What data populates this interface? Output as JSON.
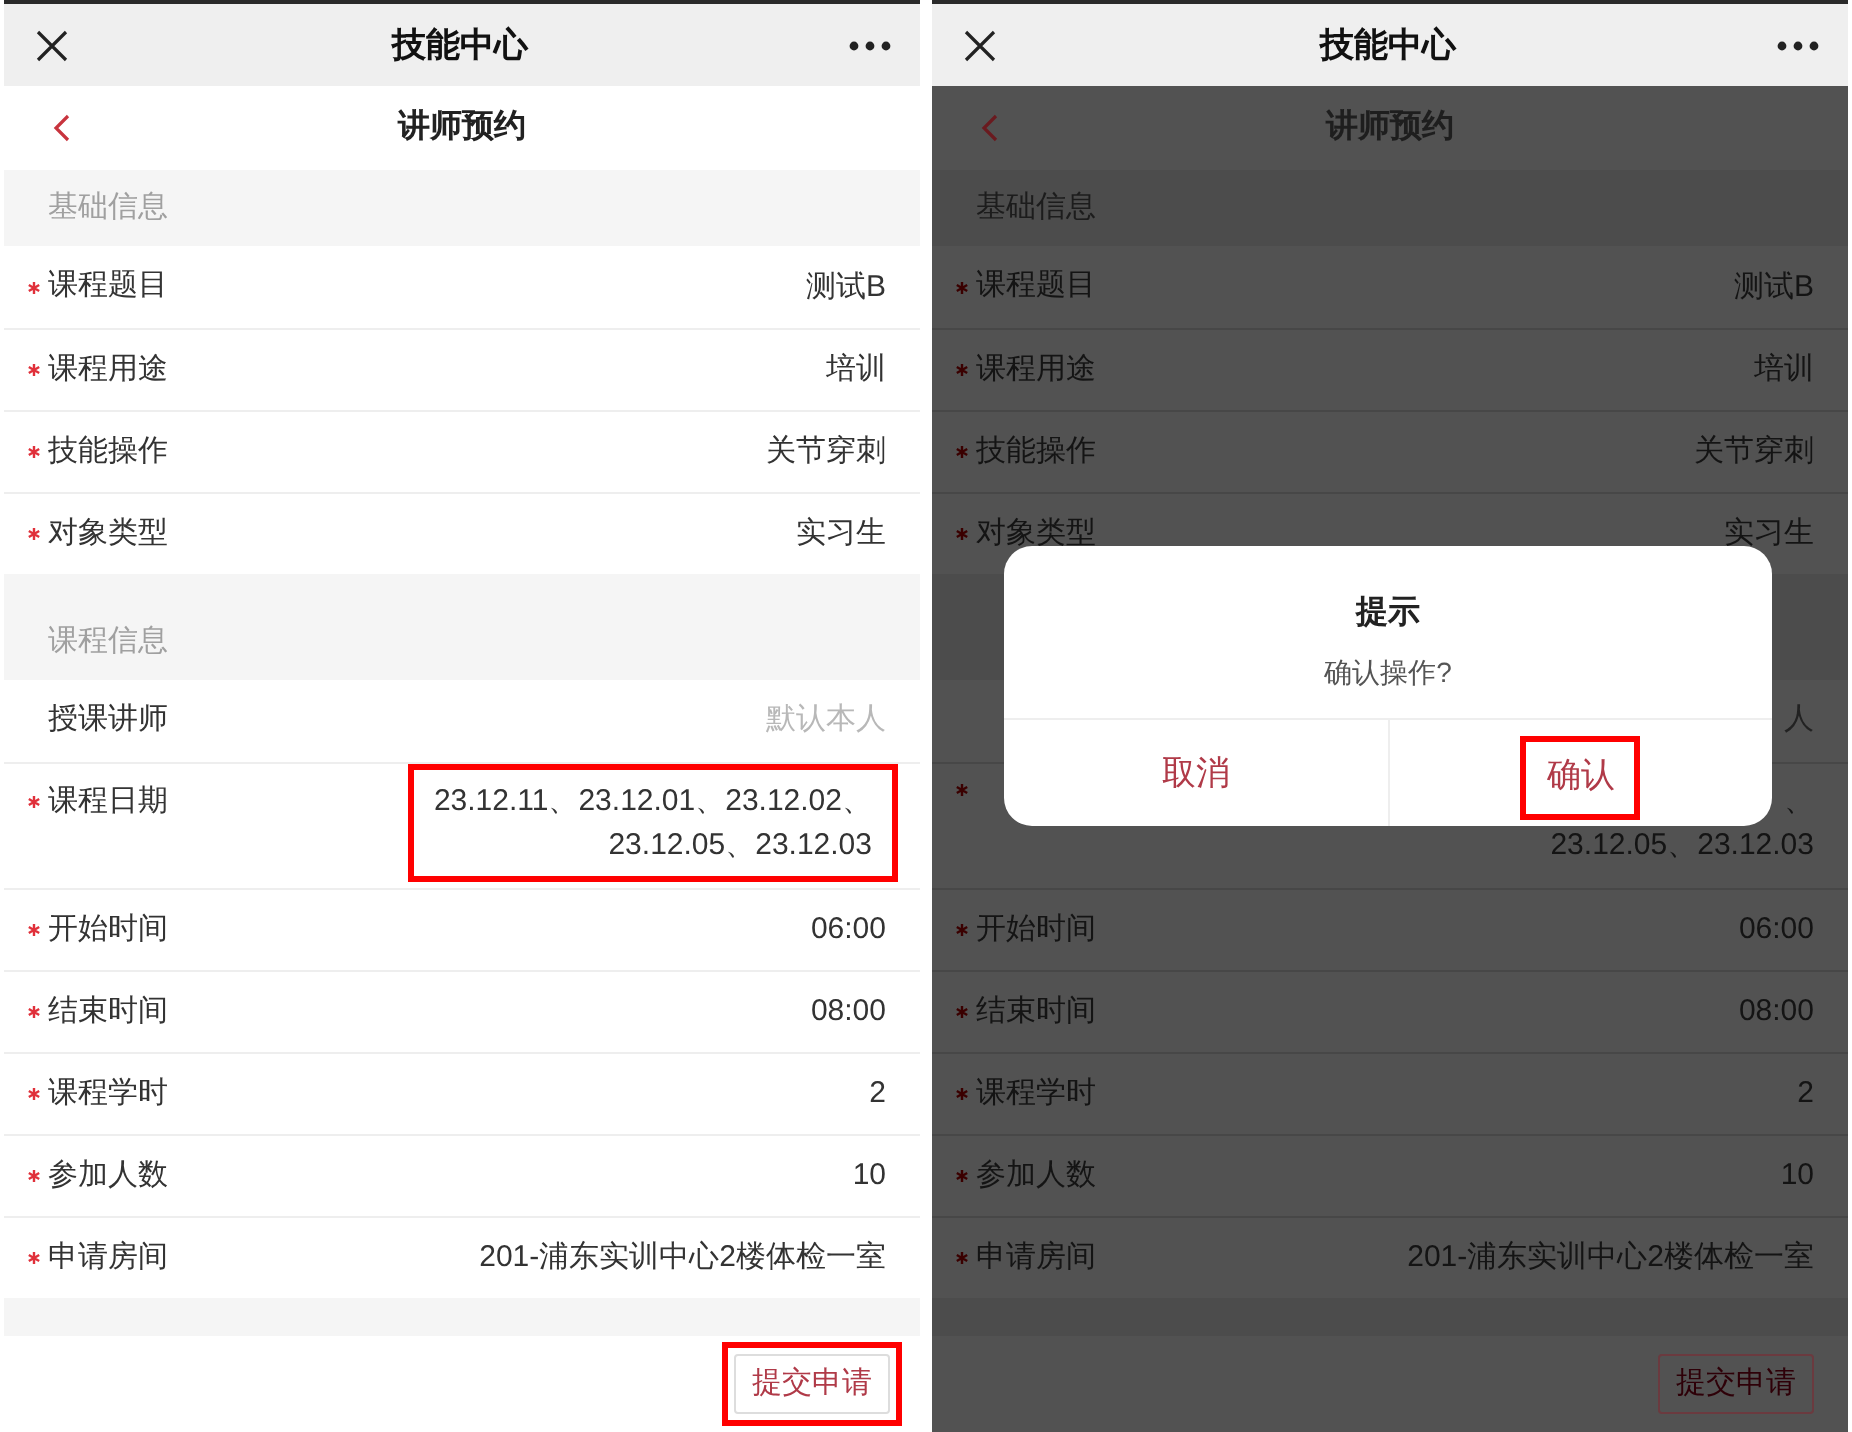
{
  "screens": [
    {
      "header": {
        "title": "技能中心"
      },
      "page_title": "讲师预约",
      "dimmed": false,
      "sections": [
        {
          "title": "基础信息",
          "rows": [
            {
              "label": "课程题目",
              "required": true,
              "value_lines": [
                "测试B"
              ]
            },
            {
              "label": "课程用途",
              "required": true,
              "value_lines": [
                "培训"
              ]
            },
            {
              "label": "技能操作",
              "required": true,
              "value_lines": [
                "关节穿刺"
              ]
            },
            {
              "label": "对象类型",
              "required": true,
              "value_lines": [
                "实习生"
              ]
            }
          ]
        },
        {
          "title": "课程信息",
          "rows": [
            {
              "label": "授课讲师",
              "required": false,
              "placeholder": "默认本人"
            },
            {
              "label": "课程日期",
              "required": true,
              "highlighted": true,
              "value_lines": [
                "23.12.11、23.12.01、23.12.02、",
                "23.12.05、23.12.03"
              ]
            },
            {
              "label": "开始时间",
              "required": true,
              "value_lines": [
                "06:00"
              ]
            },
            {
              "label": "结束时间",
              "required": true,
              "value_lines": [
                "08:00"
              ]
            },
            {
              "label": "课程学时",
              "required": true,
              "value_lines": [
                "2"
              ]
            },
            {
              "label": "参加人数",
              "required": true,
              "value_lines": [
                "10"
              ]
            },
            {
              "label": "申请房间",
              "required": true,
              "value_lines": [
                "201-浦东实训中心2楼体检一室"
              ]
            }
          ]
        }
      ],
      "submit_button": {
        "label": "提交申请",
        "highlighted": true
      }
    },
    {
      "header": {
        "title": "技能中心"
      },
      "page_title": "讲师预约",
      "dimmed": true,
      "sections": [
        {
          "title": "基础信息",
          "rows": [
            {
              "label": "课程题目",
              "required": true,
              "value_lines": [
                "测试B"
              ]
            },
            {
              "label": "课程用途",
              "required": true,
              "value_lines": [
                "培训"
              ]
            },
            {
              "label": "技能操作",
              "required": true,
              "value_lines": [
                "关节穿刺"
              ]
            },
            {
              "label": "对象类型",
              "required": true,
              "value_lines": [
                "实习生"
              ]
            }
          ]
        },
        {
          "rows": [
            {
              "placeholder": "人"
            },
            {
              "required": true,
              "highlighted": false,
              "value_lines": [
                "、",
                "23.12.05、23.12.03"
              ]
            },
            {
              "label": "开始时间",
              "required": true,
              "value_lines": [
                "06:00"
              ]
            },
            {
              "label": "结束时间",
              "required": true,
              "value_lines": [
                "08:00"
              ]
            },
            {
              "label": "课程学时",
              "required": true,
              "value_lines": [
                "2"
              ]
            },
            {
              "label": "参加人数",
              "required": true,
              "value_lines": [
                "10"
              ]
            },
            {
              "label": "申请房间",
              "required": true,
              "value_lines": [
                "201-浦东实训中心2楼体检一室"
              ]
            }
          ]
        }
      ],
      "submit_button": {
        "label": "提交申请",
        "highlighted": false
      },
      "dialog": {
        "title": "提示",
        "message": "确认操作?",
        "buttons": [
          {
            "label": "取消",
            "highlighted": false
          },
          {
            "label": "确认",
            "highlighted": true
          }
        ]
      }
    }
  ]
}
